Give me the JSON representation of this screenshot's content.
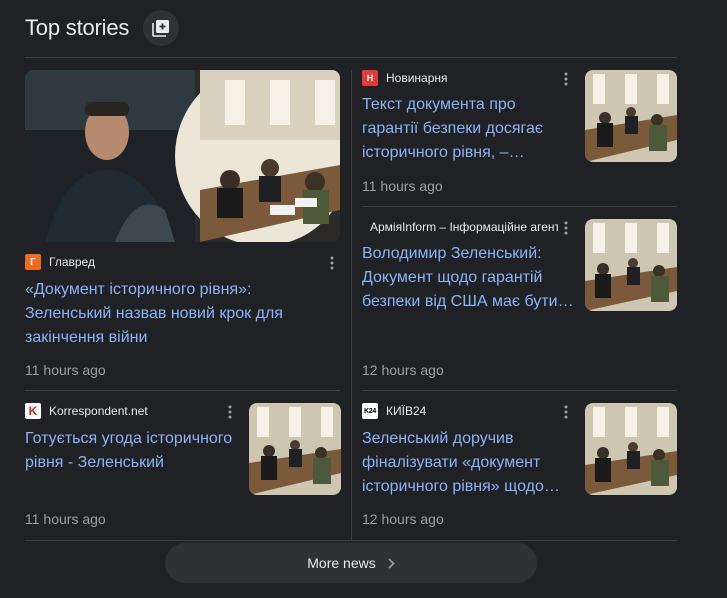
{
  "header": {
    "title": "Top stories"
  },
  "stories": [
    {
      "source": "Главред",
      "logo_char": "Г",
      "logo_bg": "#f26b1d",
      "logo_fg": "#ffffff",
      "headline": "«Документ історичного рівня»: Зеленський назвав новий крок для закінчення війни",
      "time": "11 hours ago"
    },
    {
      "source": "Новинарня",
      "logo_char": "Н",
      "logo_bg": "#e53935",
      "logo_fg": "#ffffff",
      "headline": "Текст документа про гарантії безпеки досягає історичного рівня, –…",
      "time": "11 hours ago"
    },
    {
      "source": "АрміяInform – Інформаційне агентство",
      "logo_char": "",
      "logo_bg": "#202124",
      "logo_fg": "#ffffff",
      "headline": "Володимир Зеленський: Документ щодо гарантій безпеки від США має бути…",
      "time": "12 hours ago"
    },
    {
      "source": "Korrespondent.net",
      "logo_char": "K",
      "logo_bg": "#ffffff",
      "logo_fg": "#c62828",
      "headline": "Готується угода історичного рівня - Зеленський",
      "time": "11 hours ago"
    },
    {
      "source": "КИЇВ24",
      "logo_char": "K24",
      "logo_bg": "#ffffff",
      "logo_fg": "#000000",
      "headline": "Зеленський доручив фіналізувати «документ історичного рівня» щодо…",
      "time": "12 hours ago"
    }
  ],
  "more_news": {
    "label": "More news"
  },
  "icons": {
    "header_button": "full-coverage-icon",
    "menu": "more-vert-icon",
    "chevron": "chevron-right-icon"
  }
}
